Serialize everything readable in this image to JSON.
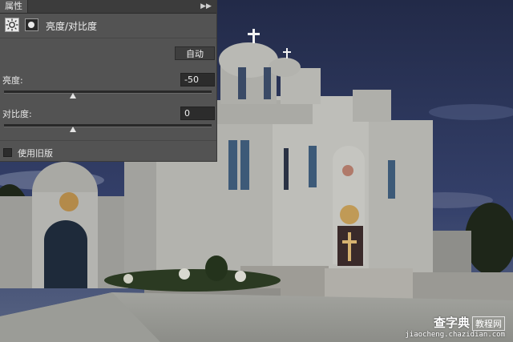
{
  "panel": {
    "tab_label": "属性",
    "menu_icon": "double-chevron-right-icon",
    "adjustment_icon": "sun-brightness-icon",
    "mask_icon": "layer-mask-icon",
    "title": "亮度/对比度",
    "auto_button": "自动",
    "brightness": {
      "label": "亮度:",
      "value": "-50",
      "slider_value": -50,
      "slider_min": -150,
      "slider_max": 150
    },
    "contrast": {
      "label": "对比度:",
      "value": "0",
      "slider_value": 0,
      "slider_min": -50,
      "slider_max": 100
    },
    "use_legacy": {
      "label": "使用旧版",
      "checked": false
    }
  },
  "watermark": {
    "main": "查字典",
    "box": "教程网",
    "sub": "jiaocheng.chazidian.com"
  },
  "colors": {
    "panel_bg": "#535353",
    "sky": "#2a3150",
    "building": "#b9b9b4"
  }
}
